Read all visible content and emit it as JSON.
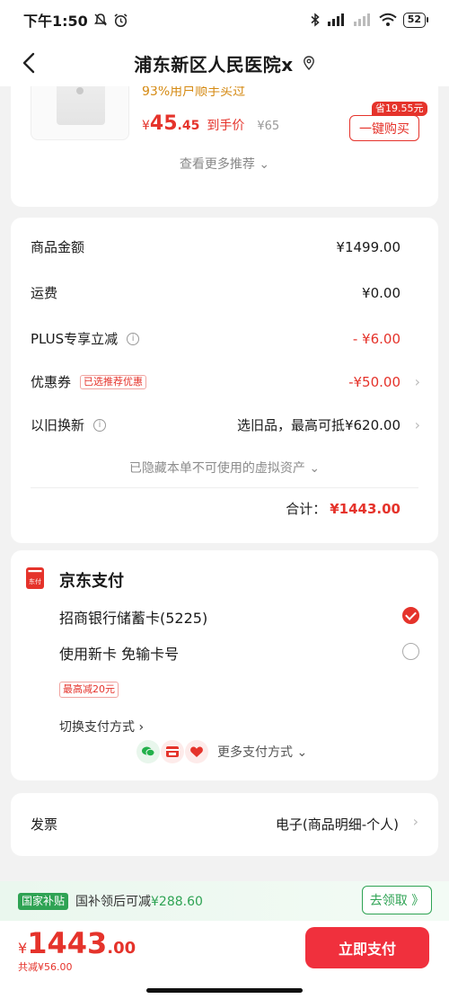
{
  "status_bar": {
    "time": "下午1:50",
    "battery": "52"
  },
  "nav": {
    "title": "浦东新区人民医院x",
    "icons": [
      "back-arrow-icon",
      "location-pin-icon"
    ]
  },
  "product": {
    "hint": "93%用户顺手买过",
    "price_currency": "¥",
    "price_int": "45",
    "price_dec": ".45",
    "price_label": "到手价",
    "original_price": "¥65",
    "save_badge": "省19.55元",
    "buy_label": "一键购买",
    "more_recommend": "查看更多推荐"
  },
  "summary": {
    "rows": [
      {
        "label": "商品金额",
        "value": "¥1499.00"
      },
      {
        "label": "运费",
        "value": "¥0.00"
      },
      {
        "label": "PLUS专享立减",
        "value": "- ¥6.00"
      },
      {
        "label": "优惠券",
        "tag": "已选推荐优惠",
        "value": "-¥50.00"
      },
      {
        "label": "以旧换新",
        "value": "选旧品，最高可抵¥620.00"
      }
    ],
    "hidden_assets": "已隐藏本单不可使用的虚拟资产",
    "total_label": "合计：",
    "total_value": "¥1443.00"
  },
  "payment": {
    "logo_text": "东付",
    "title": "京东支付",
    "options": [
      {
        "label": "招商银行储蓄卡(5225)",
        "selected": true
      },
      {
        "label": "使用新卡 免输卡号",
        "selected": false
      }
    ],
    "max_reduce_tag": "最高减20元",
    "switch_label": "切换支付方式",
    "more_methods_label": "更多支付方式",
    "more_method_icons": [
      "wechat-pay-icon",
      "bank-card-icon",
      "credit-pay-icon"
    ]
  },
  "invoice": {
    "label": "发票",
    "value": "电子(商品明细-个人)"
  },
  "subsidy": {
    "badge": "国家补贴",
    "text_prefix": "国补领后可减",
    "amount": "¥288.60",
    "button": "去领取 》"
  },
  "footer": {
    "currency": "¥",
    "price_int": "1443",
    "price_dec": ".00",
    "discount_text": "共减¥56.00",
    "pay_button": "立即支付"
  },
  "colors": {
    "accent_red": "#e5332b",
    "subsidy_green": "#2fa354"
  }
}
